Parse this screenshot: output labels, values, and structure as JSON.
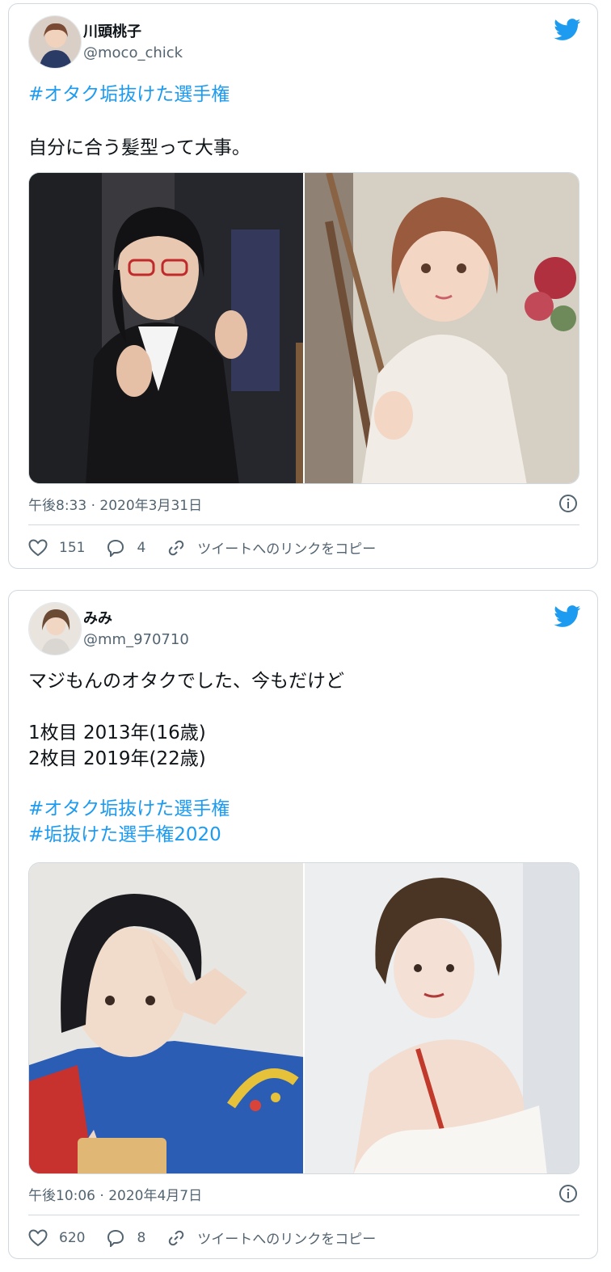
{
  "tweets": [
    {
      "display_name": "川頭桃子",
      "handle": "@moco_chick",
      "hashtags_top": "#オタク垢抜けた選手権",
      "body": "自分に合う髪型って大事。",
      "timestamp": "午後8:33 · 2020年3月31日",
      "likes": "151",
      "replies": "4",
      "copy_link": "ツイートへのリンクをコピー",
      "images": [
        "before-photo",
        "after-photo"
      ]
    },
    {
      "display_name": "みみ",
      "handle": "@mm_970710",
      "body": "マジもんのオタクでした、今もだけど\n\n1枚目 2013年(16歳)\n2枚目 2019年(22歳)",
      "hashtags_bottom": [
        "#オタク垢抜けた選手権",
        "#垢抜けた選手権2020"
      ],
      "timestamp": "午後10:06 · 2020年4月7日",
      "likes": "620",
      "replies": "8",
      "copy_link": "ツイートへのリンクをコピー",
      "images": [
        "before-photo",
        "after-photo"
      ]
    }
  ],
  "colors": {
    "accent": "#1d9bf0",
    "text": "#0f1419",
    "muted": "#536471",
    "border": "#cfd9de"
  },
  "icons": [
    "twitter-bird-icon",
    "heart-icon",
    "reply-icon",
    "link-icon",
    "info-icon"
  ]
}
